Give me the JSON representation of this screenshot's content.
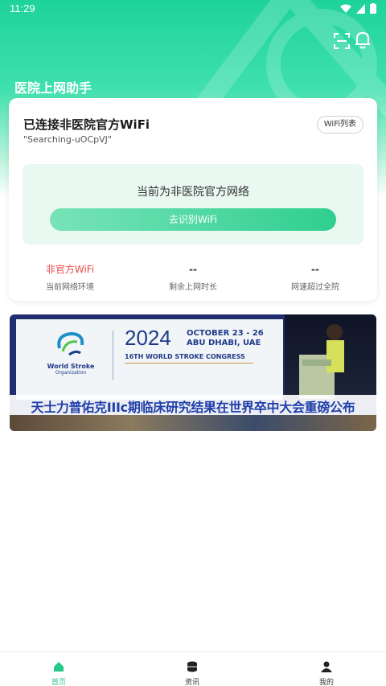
{
  "status_bar": {
    "time": "11:29"
  },
  "app": {
    "title": "医院上网助手"
  },
  "wifi_card": {
    "status": "已连接非医院官方WiFi",
    "ssid": "\"Searching-uOCpVJ\"",
    "list_button": "WiFi列表",
    "network_notice": "当前为非医院官方网络",
    "identify_button": "去识别WiFi",
    "stats": [
      {
        "value": "非官方WiFi",
        "label": "当前网络环境"
      },
      {
        "value": "--",
        "label": "剩余上网时长"
      },
      {
        "value": "--",
        "label": "网速超过全院"
      }
    ]
  },
  "banner": {
    "org_name": "World Stroke",
    "org_sub": "Organization",
    "year": "2024",
    "dates": "OCTOBER 23 - 26",
    "location": "ABU DHABI, UAE",
    "congress": "16TH WORLD STROKE CONGRESS",
    "headline": "天士力普佑克IIIc期临床研究结果在世界卒中大会重磅公布"
  },
  "bottom_nav": [
    {
      "label": "首页",
      "icon": "home-icon",
      "active": true
    },
    {
      "label": "资讯",
      "icon": "database-icon",
      "active": false
    },
    {
      "label": "我的",
      "icon": "person-icon",
      "active": false
    }
  ],
  "colors": {
    "brand": "#27c98a",
    "alert": "#ea4a4a",
    "banner_blue": "#1f3faa"
  }
}
